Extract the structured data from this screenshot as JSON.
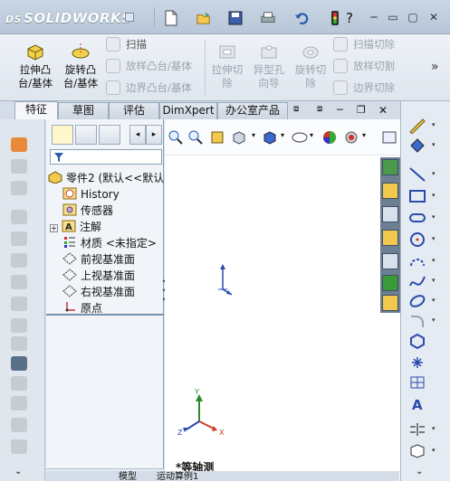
{
  "app": {
    "name": "SOLIDWORKS",
    "brand_prefix": "DS",
    "menu_caret": "▸"
  },
  "quick_access": [
    {
      "name": "new-doc-icon"
    },
    {
      "name": "open-icon"
    },
    {
      "name": "save-icon"
    },
    {
      "name": "print-icon"
    },
    {
      "name": "undo-icon"
    },
    {
      "name": "rebuild-icon"
    },
    {
      "name": "help-icon"
    }
  ],
  "window_controls": {
    "minimize": "─",
    "restore": "▭",
    "close": "✕"
  },
  "ribbon": {
    "big_tools": [
      {
        "label": "拉伸凸\n台/基体",
        "enabled": true
      },
      {
        "label": "旋转凸\n台/基体",
        "enabled": true
      },
      {
        "label": "拉伸切\n除",
        "enabled": false
      },
      {
        "label": "异型孔\n向导",
        "enabled": false
      },
      {
        "label": "旋转切\n除",
        "enabled": false
      }
    ],
    "small_tools_left": [
      {
        "label": "扫描",
        "enabled": false
      },
      {
        "label": "放样凸台/基体",
        "enabled": false
      },
      {
        "label": "边界凸台/基体",
        "enabled": false
      }
    ],
    "small_tools_right": [
      {
        "label": "扫描切除",
        "enabled": false
      },
      {
        "label": "放样切割",
        "enabled": false
      },
      {
        "label": "边界切除",
        "enabled": false
      }
    ],
    "overflow": "»"
  },
  "tabs": [
    {
      "label": "特征",
      "active": true
    },
    {
      "label": "草图",
      "active": false
    },
    {
      "label": "评估",
      "active": false
    },
    {
      "label": "DimXpert",
      "active": false
    },
    {
      "label": "办公室产品",
      "active": false
    }
  ],
  "feature_tree": {
    "root": "零件2 (默认<<默认",
    "items": [
      {
        "label": "History",
        "icon": "history-icon"
      },
      {
        "label": "传感器",
        "icon": "sensor-icon"
      },
      {
        "label": "注解",
        "icon": "annotation-icon"
      },
      {
        "label": "材质 <未指定>",
        "icon": "material-icon"
      },
      {
        "label": "前视基准面",
        "icon": "plane-icon"
      },
      {
        "label": "上视基准面",
        "icon": "plane-icon"
      },
      {
        "label": "右视基准面",
        "icon": "plane-icon"
      },
      {
        "label": "原点",
        "icon": "origin-icon"
      }
    ]
  },
  "view": {
    "name": "*等轴测",
    "axes": {
      "x": "X",
      "y": "Y",
      "z": "Z"
    }
  },
  "bottom_tabs": [
    "模型",
    "运动算例1"
  ],
  "colors": {
    "accent": "#2a5cad",
    "x_axis": "#d23a2a",
    "y_axis": "#2a8a2a",
    "z_axis": "#2a4aad"
  }
}
